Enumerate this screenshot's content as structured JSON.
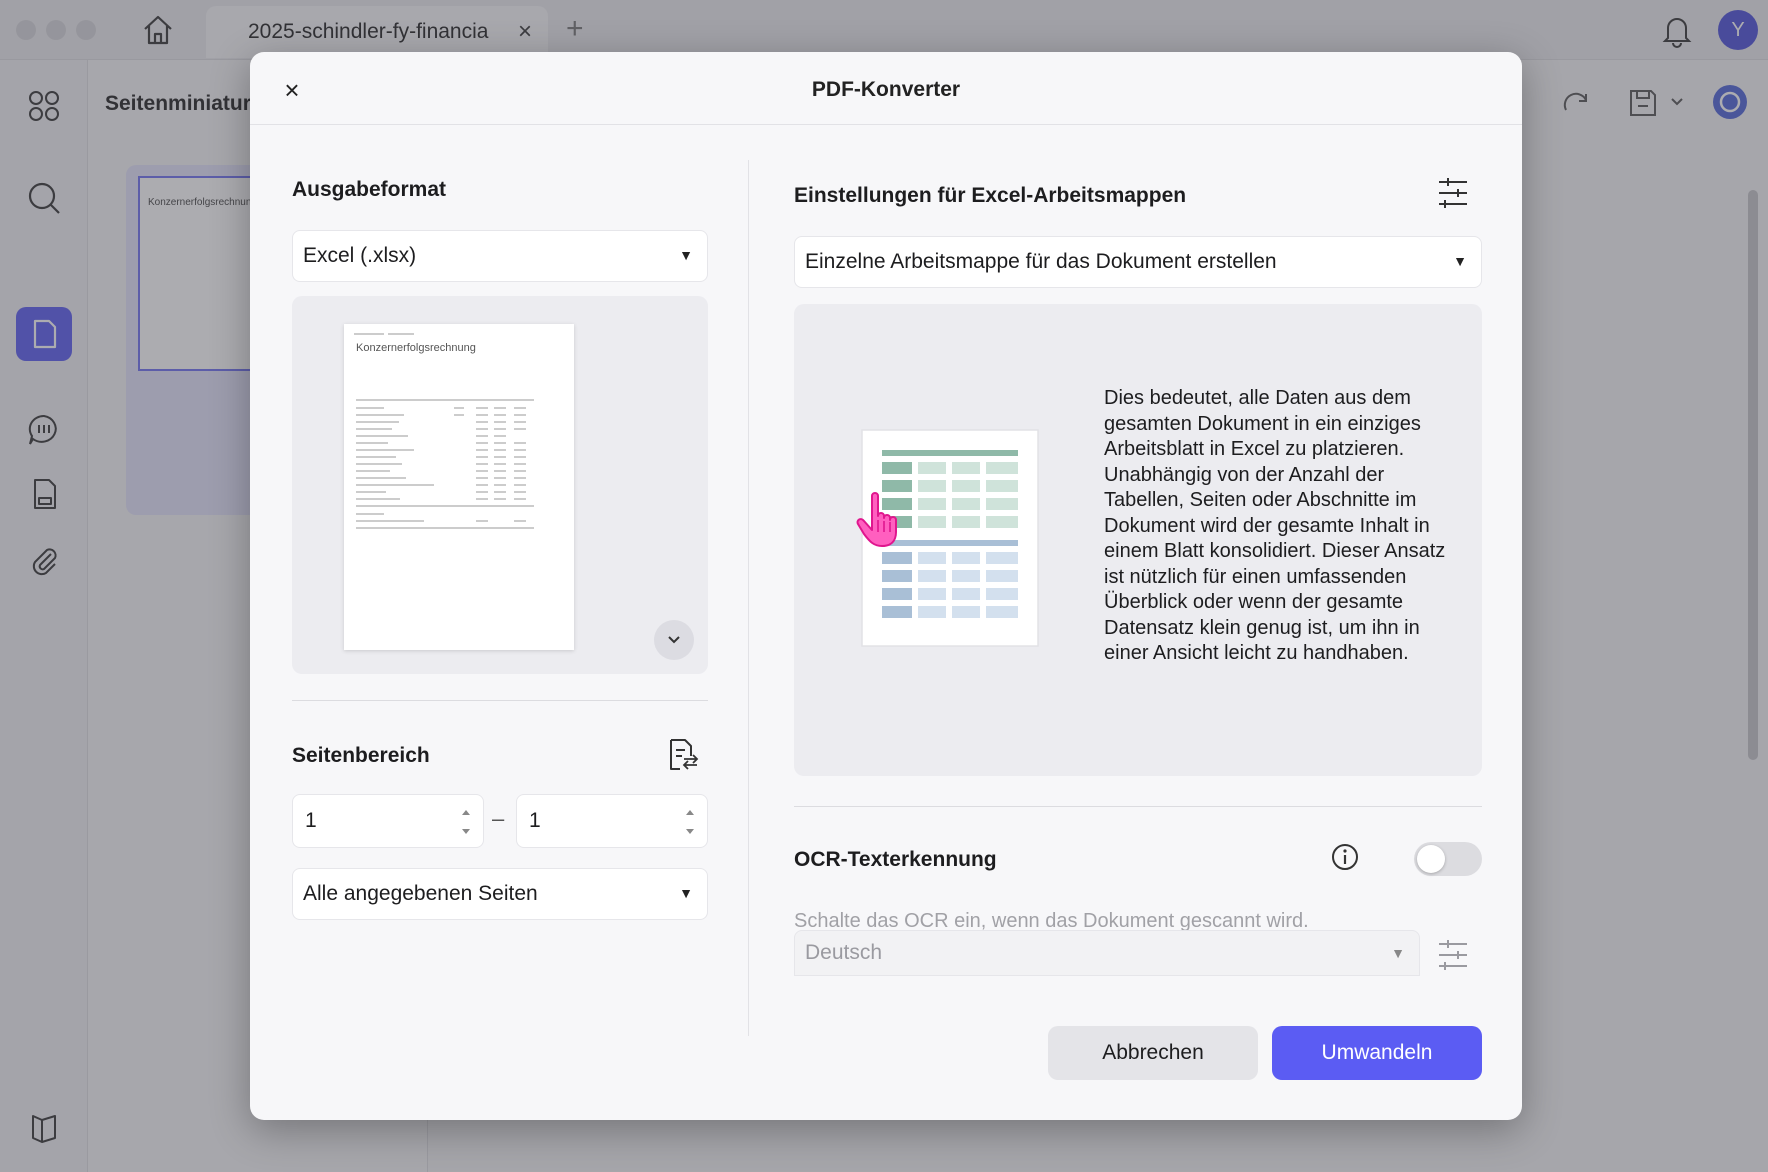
{
  "tab": {
    "title": "2025-schindler-fy-financia",
    "close": "×",
    "add": "+"
  },
  "user": {
    "avatar_initial": "Y"
  },
  "thumbnails": {
    "panel_title": "Seitenminiatur",
    "page_title": "Konzernerfolgsrechnun"
  },
  "dialog": {
    "close": "×",
    "title": "PDF-Konverter",
    "output_format": {
      "title": "Ausgabeformat",
      "selected": "Excel (.xlsx)",
      "preview_page_title": "Konzernerfolgsrechnung"
    },
    "page_range": {
      "title": "Seitenbereich",
      "from": "1",
      "dash": "–",
      "to": "1",
      "subset": "Alle angegebenen Seiten"
    },
    "excel_settings": {
      "title": "Einstellungen für Excel-Arbeitsmappen",
      "selected": "Einzelne Arbeitsmappe für das Dokument erstellen",
      "description": "Dies bedeutet, alle Daten aus dem gesamten Dokument in ein einziges Arbeitsblatt in Excel zu platzieren. Unabhängig von der Anzahl der Tabellen, Seiten oder Abschnitte im Dokument wird der gesamte Inhalt in einem Blatt konsolidiert. Dieser Ansatz ist nützlich für einen umfassenden Überblick oder wenn der gesamte Datensatz klein genug ist, um ihn in einer Ansicht leicht zu handhaben."
    },
    "ocr": {
      "title": "OCR-Texterkennung",
      "enabled": false,
      "hint": "Schalte das OCR ein, wenn das Dokument gescannt wird.",
      "language": "Deutsch"
    },
    "buttons": {
      "cancel": "Abbrechen",
      "convert": "Umwandeln"
    }
  },
  "colors": {
    "accent": "#5b5cf3",
    "sheet_header": "#8fb9a8",
    "sheet_body": "#a9bfd6"
  }
}
